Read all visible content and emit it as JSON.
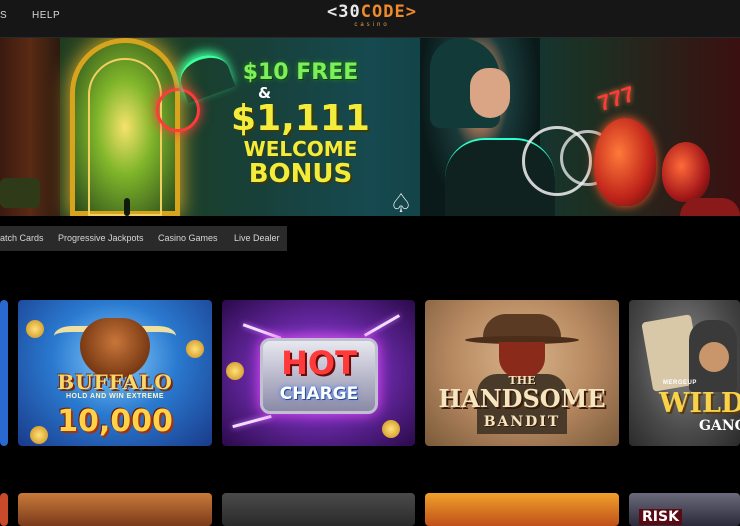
{
  "header": {
    "nav": [
      "S",
      "HELP"
    ],
    "logo": {
      "mark_left": "<30",
      "mark_right": "CODE>",
      "subtitle": "casino"
    }
  },
  "hero": {
    "line1": "$10 FREE",
    "line2": "&",
    "line3": "$1,111",
    "line4": "WELCOME",
    "line5": "BONUS",
    "spade_glyph": "♤",
    "sevens": "777"
  },
  "categories": {
    "tabs": [
      "atch Cards",
      "Progressive Jackpots",
      "Casino Games",
      "Live Dealer"
    ]
  },
  "games": {
    "row1": [
      {
        "title": "BUFFALO",
        "subtitle": "HOLD AND WIN EXTREME",
        "amount": "10,000"
      },
      {
        "title": "HOT",
        "subtitle": "CHARGE"
      },
      {
        "pre": "THE",
        "title": "HANDSOME",
        "subtitle": "BANDIT"
      },
      {
        "pre": "MERGEUP",
        "title": "WILD C",
        "subtitle": "GANG"
      }
    ],
    "row2": [
      {
        "label": "RISK"
      }
    ]
  },
  "colors": {
    "header_bg": "#161616",
    "tab_bg": "#2a2a2a",
    "promo_green": "#7cf05a",
    "promo_yellow": "#f4ec3a"
  }
}
